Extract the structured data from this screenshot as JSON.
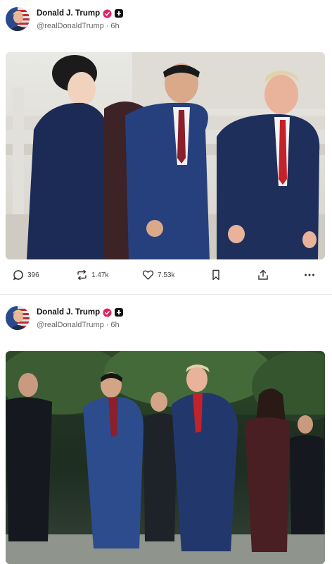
{
  "posts": [
    {
      "author": {
        "display_name": "Donald J. Trump",
        "handle": "@realDonaldTrump",
        "time_ago": "6h"
      },
      "stats": {
        "replies": "396",
        "reposts": "1.47k",
        "likes": "7.53k"
      },
      "icons": {
        "reply": "reply-icon",
        "repost": "repost-icon",
        "like": "heart-icon",
        "bookmark": "bookmark-icon",
        "share": "share-icon",
        "more": "more-icon"
      }
    },
    {
      "author": {
        "display_name": "Donald J. Trump",
        "handle": "@realDonaldTrump",
        "time_ago": "6h"
      }
    }
  ],
  "colors": {
    "verified_badge": "#e0245e",
    "text_primary": "#111111",
    "text_secondary": "#666666",
    "divider": "#e6e6e6"
  }
}
